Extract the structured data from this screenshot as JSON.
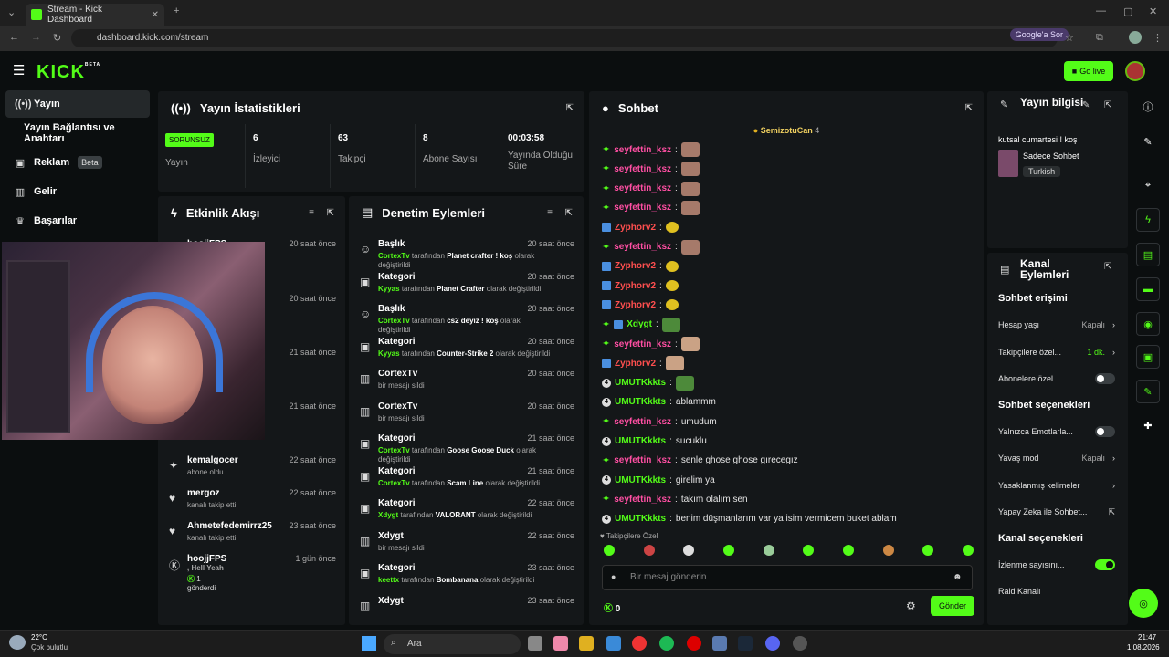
{
  "browser": {
    "tab_title": "Stream - Kick Dashboard",
    "url": "dashboard.kick.com/stream",
    "google_ask": "Google'a Sor"
  },
  "app": {
    "logo": "KICK",
    "logo_badge": "BETA",
    "go_live": "Go live",
    "brand_color": "#53fc18"
  },
  "sidebar": {
    "items": [
      {
        "label": "Yayın",
        "icon": "broadcast-icon"
      },
      {
        "label": "Yayın Bağlantısı ve Anahtarı",
        "icon": "key-icon"
      },
      {
        "label": "Reklam",
        "icon": "ad-icon",
        "badge": "Beta"
      },
      {
        "label": "Gelir",
        "icon": "chart-icon"
      },
      {
        "label": "Başarılar",
        "icon": "trophy-icon"
      }
    ]
  },
  "stats": {
    "title": "Yayın İstatistikleri",
    "items": [
      {
        "value": "SORUNSUZ",
        "label": "Yayın"
      },
      {
        "value": "6",
        "label": "İzleyici"
      },
      {
        "value": "63",
        "label": "Takipçi"
      },
      {
        "value": "8",
        "label": "Abone Sayısı"
      },
      {
        "value": "00:03:58",
        "label": "Yayında Olduğu Süre"
      }
    ]
  },
  "activity": {
    "title": "Etkinlik Akışı",
    "items": [
      {
        "user": "hoojjFPS",
        "time": "20 saat önce",
        "desc": ""
      },
      {
        "user": "",
        "time": "20 saat önce",
        "desc": ""
      },
      {
        "user": "",
        "time": "21 saat önce",
        "desc": ""
      },
      {
        "user": "",
        "time": "21 saat önce",
        "desc": ""
      },
      {
        "user": "kemalgocer",
        "time": "22 saat önce",
        "desc": "abone oldu"
      },
      {
        "user": "mergoz",
        "time": "22 saat önce",
        "desc": "kanalı takip etti"
      },
      {
        "user": "Ahmetefedemirrz25",
        "time": "23 saat önce",
        "desc": "kanalı takip etti"
      },
      {
        "user": "hoojjFPS",
        "time": "1 gün önce",
        "desc": ", Hell Yeah",
        "extra": "1",
        "extra2": "gönderdi"
      }
    ]
  },
  "moderation": {
    "title": "Denetim Eylemleri",
    "items": [
      {
        "title": "Başlık",
        "time": "20 saat önce",
        "by": "CortexTv",
        "mid": "tarafından",
        "target": "Planet crafter ! koş",
        "end": "olarak değiştirildi"
      },
      {
        "title": "Kategori",
        "time": "20 saat önce",
        "by": "Kyyas",
        "mid": "tarafından",
        "target": "Planet Crafter",
        "end": "olarak değiştirildi"
      },
      {
        "title": "Başlık",
        "time": "20 saat önce",
        "by": "CortexTv",
        "mid": "tarafından",
        "target": "cs2 deyiz ! koş",
        "end": "olarak değiştirildi"
      },
      {
        "title": "Kategori",
        "time": "20 saat önce",
        "by": "Kyyas",
        "mid": "tarafından",
        "target": "Counter-Strike 2",
        "end": "olarak değiştirildi"
      },
      {
        "title": "CortexTv",
        "time": "20 saat önce",
        "by": "",
        "mid": "bir mesajı sildi",
        "target": "",
        "end": ""
      },
      {
        "title": "CortexTv",
        "time": "20 saat önce",
        "by": "",
        "mid": "bir mesajı sildi",
        "target": "",
        "end": ""
      },
      {
        "title": "Kategori",
        "time": "21 saat önce",
        "by": "CortexTv",
        "mid": "tarafından",
        "target": "Goose Goose Duck",
        "end": "olarak değiştirildi"
      },
      {
        "title": "Kategori",
        "time": "21 saat önce",
        "by": "CortexTv",
        "mid": "tarafından",
        "target": "Scam Line",
        "end": "olarak değiştirildi"
      },
      {
        "title": "Kategori",
        "time": "22 saat önce",
        "by": "Xdygt",
        "mid": "tarafından",
        "target": "VALORANT",
        "end": "olarak değiştirildi"
      },
      {
        "title": "Xdygt",
        "time": "22 saat önce",
        "by": "",
        "mid": "bir mesajı sildi",
        "target": "",
        "end": ""
      },
      {
        "title": "Kategori",
        "time": "23 saat önce",
        "by": "keettx",
        "mid": "tarafından",
        "target": "Bombanana",
        "end": "olarak değiştirildi"
      },
      {
        "title": "Xdygt",
        "time": "23 saat önce",
        "by": "",
        "mid": "",
        "target": "",
        "end": ""
      }
    ]
  },
  "chat": {
    "title": "Sohbet",
    "pinned_user": "SemizotuCan",
    "pinned_count": "4",
    "messages": [
      {
        "user": "seyfettin_ksz",
        "color": "pink",
        "badge": "star",
        "text": "",
        "emote": "cat"
      },
      {
        "user": "seyfettin_ksz",
        "color": "pink",
        "badge": "star",
        "text": "",
        "emote": "cat"
      },
      {
        "user": "seyfettin_ksz",
        "color": "pink",
        "badge": "star",
        "text": "",
        "emote": "cat"
      },
      {
        "user": "seyfettin_ksz",
        "color": "pink",
        "badge": "star",
        "text": "",
        "emote": "cat"
      },
      {
        "user": "Zyphorv2",
        "color": "red",
        "badge": "blue",
        "text": "",
        "emote": "duck"
      },
      {
        "user": "seyfettin_ksz",
        "color": "pink",
        "badge": "star",
        "text": "",
        "emote": "cat"
      },
      {
        "user": "Zyphorv2",
        "color": "red",
        "badge": "blue",
        "text": "",
        "emote": "duck"
      },
      {
        "user": "Zyphorv2",
        "color": "red",
        "badge": "blue",
        "text": "",
        "emote": "duck"
      },
      {
        "user": "Zyphorv2",
        "color": "red",
        "badge": "blue",
        "text": "",
        "emote": "duck"
      },
      {
        "user": "Xdygt",
        "color": "green",
        "badge": "starblue",
        "text": "",
        "emote": "frog"
      },
      {
        "user": "seyfettin_ksz",
        "color": "pink",
        "badge": "star",
        "text": "",
        "emote": "face"
      },
      {
        "user": "Zyphorv2",
        "color": "red",
        "badge": "blue",
        "text": "",
        "emote": "face"
      },
      {
        "user": "UMUTKkkts",
        "color": "green",
        "badge": "num",
        "text": "",
        "emote": "frog"
      },
      {
        "user": "UMUTKkkts",
        "color": "green",
        "badge": "num",
        "text": "ablammm",
        "emote": ""
      },
      {
        "user": "seyfettin_ksz",
        "color": "pink",
        "badge": "star",
        "text": "umudum",
        "emote": ""
      },
      {
        "user": "UMUTKkkts",
        "color": "green",
        "badge": "num",
        "text": "sucuklu",
        "emote": ""
      },
      {
        "user": "seyfettin_ksz",
        "color": "pink",
        "badge": "star",
        "text": "senle ghose ghose gırecegız",
        "emote": ""
      },
      {
        "user": "UMUTKkkts",
        "color": "green",
        "badge": "num",
        "text": "girelim ya",
        "emote": ""
      },
      {
        "user": "seyfettin_ksz",
        "color": "pink",
        "badge": "star",
        "text": "takım olalım sen",
        "emote": ""
      },
      {
        "user": "UMUTKkkts",
        "color": "green",
        "badge": "num",
        "text": "benim düşmanlarım var ya isim vermicem buket ablam",
        "emote": ""
      }
    ],
    "follower_emotes_label": "Takipçilere Özel",
    "input_placeholder": "Bir mesaj gönderin",
    "points": "0",
    "send": "Gönder"
  },
  "stream_info": {
    "title": "Yayın bilgisi",
    "stream_title": "kutsal cumartesi ! koş",
    "category": "Sadece Sohbet",
    "language": "Turkish"
  },
  "channel_actions": {
    "title": "Kanal Eylemleri",
    "sections": [
      {
        "heading": "Sohbet erişimi",
        "rows": [
          {
            "label": "Hesap yaşı",
            "value": "Kapalı",
            "kind": "arrow"
          },
          {
            "label": "Takipçilere özel...",
            "value": "1 dk.",
            "kind": "arrow-green"
          },
          {
            "label": "Abonelere özel...",
            "value": "",
            "kind": "toggle-off"
          }
        ]
      },
      {
        "heading": "Sohbet seçenekleri",
        "rows": [
          {
            "label": "Yalnızca Emotlarla...",
            "value": "",
            "kind": "toggle-off"
          },
          {
            "label": "Yavaş mod",
            "value": "Kapalı",
            "kind": "arrow"
          },
          {
            "label": "Yasaklanmış kelimeler",
            "value": "",
            "kind": "arrow"
          },
          {
            "label": "Yapay Zeka ile Sohbet...",
            "value": "",
            "kind": "link"
          }
        ]
      },
      {
        "heading": "Kanal seçenekleri",
        "rows": [
          {
            "label": "İzlenme sayısını...",
            "value": "",
            "kind": "toggle-on"
          },
          {
            "label": "Raid Kanalı",
            "value": "",
            "kind": "none"
          }
        ]
      }
    ]
  },
  "taskbar": {
    "weather_temp": "22°C",
    "weather_desc": "Çok bulutlu",
    "search": "Ara",
    "time": "21:47",
    "date": "1.08.2026"
  }
}
